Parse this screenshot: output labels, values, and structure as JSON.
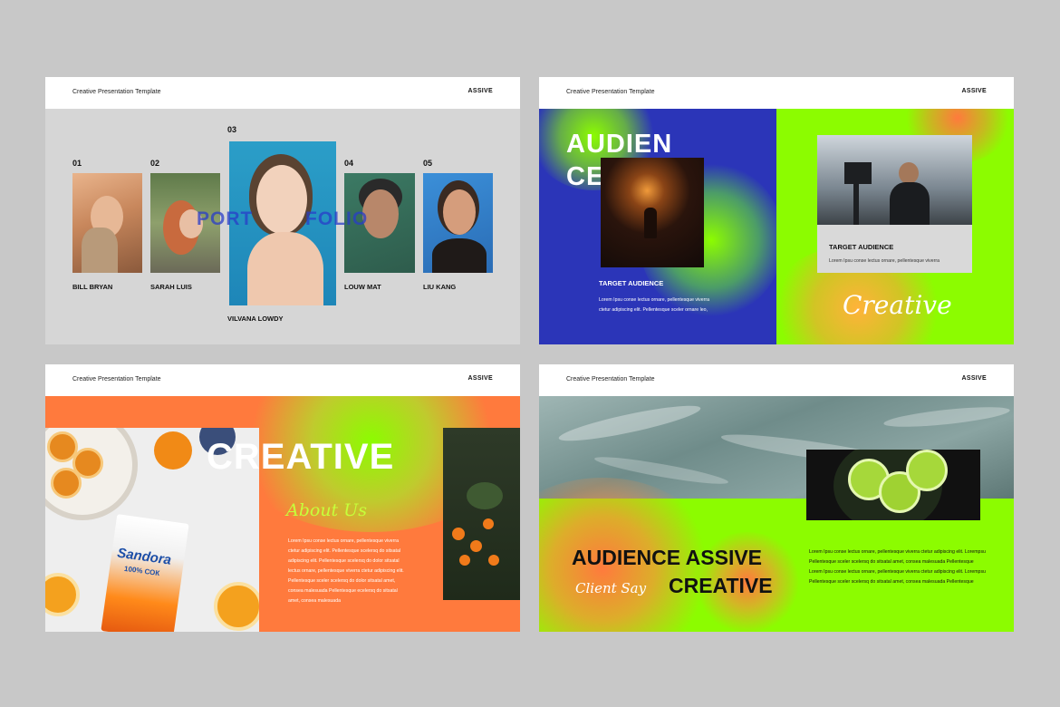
{
  "header": {
    "title": "Creative Presentation Template",
    "brand": "ASSIVE"
  },
  "slide1": {
    "members": [
      {
        "num": "01",
        "name": "BILL BRYAN"
      },
      {
        "num": "02",
        "name": "SARAH LUIS"
      },
      {
        "num": "03",
        "name": "VILVANA LOWDY"
      },
      {
        "num": "04",
        "name": "LOUW MAT"
      },
      {
        "num": "05",
        "name": "LIU KANG"
      }
    ],
    "overlay_left": "PORT",
    "overlay_right": "FOLIO"
  },
  "slide2": {
    "title_line1": "AUDIEN",
    "title_line2": "CE",
    "target_left": "TARGET AUDIENCE",
    "text_left": [
      "Lorem Ipsu conse lectus ornare, pellentesque viverra",
      "ctetur adipiscing elit. Pellentesque sceler ornare leo,"
    ],
    "target_right": "TARGET AUDIENCE",
    "text_right": [
      "Lorem Ipsu conse lectus ornare, pellentesque viverra"
    ],
    "script": "Creative"
  },
  "slide3": {
    "title": "CREATIVE",
    "script": "About Us",
    "paragraph": [
      "Lorem Ipsu conse lectus ornare, pellentesque viverra",
      "ctetur adipiscing elit. Pellentesque scelersq do sitsatal",
      "adipiscing elit. Pellentesque scelersq do dolor sitsatal",
      "lectus ornare, pellentesque viverra ctetur adipiscing elit.",
      "Pellentesque sceler scelersq do dolor sitsatal amet,",
      "consea malesuada Pellentesque ecelersq do sitsatal",
      "amet, consea malesuada"
    ],
    "brand_text": "Sandora",
    "brand_sub": "100% СОК"
  },
  "slide4": {
    "title_line1": "AUDIENCE ASSIVE",
    "title_line2": "CREATIVE",
    "script": "Client Say",
    "paragraph": [
      "Lorem Ipsu conse lectus ornare, pellentesque viverra ctetur adipiscing elit. Lorempsu",
      "Pellentesque sceler scelersq do sitsatal amet, consea malesuada Pellentesque",
      "Lorem Ipsu conse lectus ornare, pellentesque viverra ctetur adipiscing elit. Lorempsu",
      "Pellentesque sceler scelersq do sitsatal amet, consea malesuada Pellentesque"
    ]
  },
  "colors": {
    "lime": "#8cfc00",
    "blue": "#2b35b8",
    "orange": "#ff7a3d",
    "grey_bg": "#d6d6d6"
  }
}
